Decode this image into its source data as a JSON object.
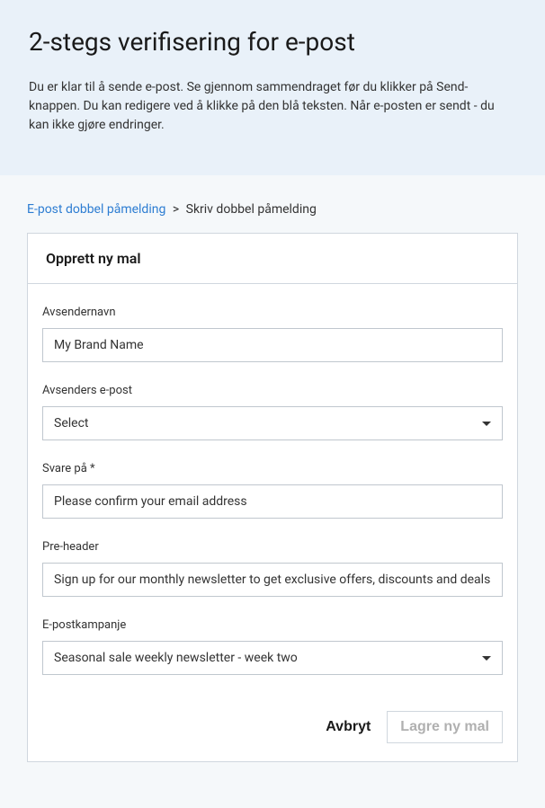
{
  "header": {
    "title": "2-stegs verifisering for e-post",
    "description": "Du er klar til å sende e-post. Se gjennom sammendraget før du klikker på Send-knappen. Du kan redigere ved å klikke på den blå teksten. Når e-posten er sendt - du kan ikke gjøre endringer."
  },
  "breadcrumb": {
    "link_label": "E-post dobbel påmelding",
    "separator": ">",
    "current": "Skriv dobbel påmelding"
  },
  "card": {
    "title": "Opprett ny mal"
  },
  "form": {
    "sender_name": {
      "label": "Avsendernavn",
      "value": "My Brand Name"
    },
    "sender_email": {
      "label": "Avsenders e-post",
      "value": "Select"
    },
    "reply_to": {
      "label": "Svare på *",
      "value": "Please confirm your email address"
    },
    "pre_header": {
      "label": "Pre-header",
      "value": "Sign up for our monthly newsletter to get exclusive offers, discounts and deals!"
    },
    "email_campaign": {
      "label": "E-postkampanje",
      "value": "Seasonal sale weekly newsletter - week two"
    }
  },
  "buttons": {
    "cancel": "Avbryt",
    "save": "Lagre ny mal"
  }
}
